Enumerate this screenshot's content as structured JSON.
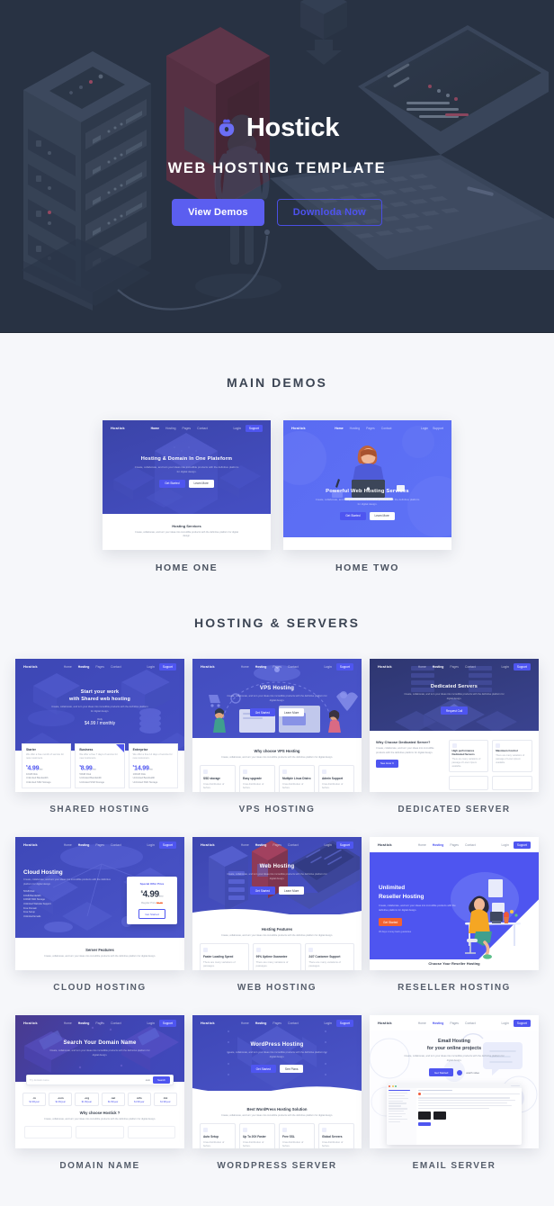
{
  "hero": {
    "brand_name": "Hostick",
    "logo_icon": "cloud-bag-icon",
    "subtitle": "WEB HOSTING TEMPLATE",
    "primary_button": "View Demos",
    "secondary_button": "Downloda Now",
    "bg_color": "#283243",
    "accent_color": "#5b5ef0"
  },
  "main_demos": {
    "title": "MAIN DEMOS",
    "items": [
      {
        "label": "HOME ONE",
        "nav": {
          "logo": "Hostick",
          "menu": [
            "Home",
            "Hosting",
            "Pages",
            "Contact"
          ],
          "active": "Home",
          "login": "Login",
          "cta": "Support"
        },
        "headline": "Hosting & Domain In One Plateform",
        "paragraph": "Create, collaborate, and turn your ideas into incredible products with the definitive platform for digital design.",
        "btn_primary": "Get Started",
        "btn_secondary": "Learn More",
        "section_title": "Hosting Services",
        "section_paragraph": "Create, collaborate, and turn your ideas into incredible products with the definitive platform for digital design."
      },
      {
        "label": "HOME TWO",
        "nav": {
          "logo": "Hostick",
          "menu": [
            "Home",
            "Hosting",
            "Pages",
            "Contact"
          ],
          "active": "Home",
          "login": "Login",
          "cta": "Support"
        },
        "headline": "Powerful Web Hosting Services",
        "paragraph": "Create, collaborate, and turn your ideas into incredible products with the definitive platform for digital design.",
        "btn_primary": "Get Started",
        "btn_secondary": "Learn More"
      }
    ]
  },
  "hosting_servers": {
    "title": "HOSTING & SERVERS",
    "items": [
      {
        "label": "SHARED HOSTING",
        "nav": {
          "logo": "Hostick",
          "menu": [
            "Home",
            "Hosting",
            "Pages",
            "Contact"
          ],
          "active": "Hosting",
          "login": "Login",
          "cta": "Support"
        },
        "headline_line1": "Start your work",
        "headline_line2": "with Shared web hosting",
        "paragraph": "Create, collaborate, and turn your ideas into incredible products with the definitive platform for digital design.",
        "offer_label": "Only",
        "offer_price": "$4.99 / monthly",
        "plans": [
          {
            "name": "Starter",
            "desc": "We offer a free month of service for new customers.",
            "price": "4.99",
            "currency": "$",
            "period": "/mo",
            "features": [
              "10GB Disk",
              "Unlimited Bandwidth",
              "Unlimited SSD Storage"
            ]
          },
          {
            "name": "Business",
            "desc": "We offer a free 7 days of service for new customers.",
            "price": "8.99",
            "currency": "$",
            "period": "/mo",
            "features": [
              "50GB Disk",
              "Unlimited Bandwidth",
              "Unlimited SSD Storage"
            ]
          },
          {
            "name": "Enterprise",
            "desc": "We offer a free 14 days of service for new customers.",
            "price": "14.99",
            "currency": "$",
            "period": "/mo",
            "features": [
              "100GB Disk",
              "Unlimited Bandwidth",
              "Unlimited SSD Storage"
            ]
          }
        ]
      },
      {
        "label": "VPS HOSTING",
        "nav": {
          "logo": "Hostick",
          "menu": [
            "Home",
            "Hosting",
            "Pages",
            "Contact"
          ],
          "active": "Hosting",
          "login": "Login",
          "cta": "Support"
        },
        "headline": "VPS Hosting",
        "paragraph": "Create, collaborate, and turn your ideas into incredible products with the definitive platform for digital design.",
        "btn_primary": "Get Started",
        "btn_secondary": "Learn More",
        "section_title": "Why choose VPS Hosting",
        "section_paragraph": "Create, collaborate, and turn your ideas into incredible products with the definitive platform for digital design.",
        "features": [
          {
            "title": "SSD storage",
            "desc": "Cras distribution of before."
          },
          {
            "title": "Easy upgrade",
            "desc": "Cras distribution of before."
          },
          {
            "title": "Multiple Linux Distro",
            "desc": "Cras distribution of before."
          },
          {
            "title": "Admin Support",
            "desc": "Cras distribution of before."
          }
        ]
      },
      {
        "label": "DEDICATED SERVER",
        "nav": {
          "logo": "Hostick",
          "menu": [
            "Home",
            "Hosting",
            "Pages",
            "Contact"
          ],
          "active": "Hosting",
          "login": "Login",
          "cta": "Support"
        },
        "headline": "Dedicated Servers",
        "paragraph": "Create, collaborate, and turn your ideas into incredible products with the definitive platform for digital design.",
        "btn_primary": "Request Call",
        "section_title": "Why Choose Dedicated Server?",
        "section_paragraph": "Create, collaborate, and turn your ideas into incredible products with the definitive platform for digital design.",
        "section_btn": "See How It",
        "cards": [
          {
            "title": "High performance Dedicated Servers",
            "desc": "There are many variations of passage of Lorem Ipsum available."
          },
          {
            "title": "Maximum Control",
            "desc": "There are many variations of passage of Lorem Ipsum available."
          }
        ]
      },
      {
        "label": "CLOUD HOSTING",
        "nav": {
          "logo": "Hostick",
          "menu": [
            "Home",
            "Hosting",
            "Pages",
            "Contact"
          ],
          "active": "Hosting",
          "login": "Login",
          "cta": "Support"
        },
        "headline": "Cloud Hosting",
        "paragraph": "Create, collaborate, and turn your ideas into incredible products with the definitive platform for digital design.",
        "bullets": [
          "50GB Disk",
          "10GB Bandwidth",
          "100GB SSD Storage",
          "Unlimited Website Support",
          "Free Domain",
          "Free Setup",
          "Unlimited Emails"
        ],
        "offer_label": "Special Offer Price",
        "offer_price": "4.99",
        "offer_currency": "$",
        "offer_period": "/mo",
        "offer_regular": "Regular Price",
        "offer_regular_price": "$9.99",
        "offer_btn": "Get Started",
        "section_title": "Server Features",
        "section_paragraph": "Create, collaborate, and turn your ideas into incredible products with the definitive platform for digital design."
      },
      {
        "label": "WEB HOSTING",
        "nav": {
          "logo": "Hostick",
          "menu": [
            "Home",
            "Hosting",
            "Pages",
            "Contact"
          ],
          "active": "Hosting",
          "login": "Login",
          "cta": "Support"
        },
        "headline": "Web Hosting",
        "paragraph": "Create, collaborate, and turn your ideas into incredible products with the definitive platform for digital design.",
        "btn_primary": "Get Started",
        "btn_secondary": "Learn More",
        "section_title": "Hosting Features",
        "section_paragraph": "Create, collaborate, and turn your ideas into incredible products with the definitive platform for digital design.",
        "features": [
          {
            "title": "Faster Loading Speed",
            "desc": "There are many variations of passages."
          },
          {
            "title": "99% Uptime Guarantee",
            "desc": "There are many variations of passages."
          },
          {
            "title": "24/7 Customer Support",
            "desc": "There are many variations of passages."
          }
        ]
      },
      {
        "label": "RESELLER HOSTING",
        "nav": {
          "logo": "Hostick",
          "menu": [
            "Home",
            "Hosting",
            "Pages",
            "Contact"
          ],
          "active": "Hosting",
          "login": "Login",
          "cta": "Support"
        },
        "headline_line1": "Unlimited",
        "headline_line2": "Reseller Hosting",
        "paragraph": "Create, collaborate, and turn your ideas into incredible products with the definitive platform for digital design.",
        "btn_primary": "Get Started",
        "note": "30 days money back guarantee",
        "section_title": "Choose Your Reseller Hosting"
      },
      {
        "label": "DOMAIN NAME",
        "nav": {
          "logo": "Hostick",
          "menu": [
            "Home",
            "Hosting",
            "Pages",
            "Contact"
          ],
          "active": "Hosting",
          "login": "Login",
          "cta": "Support"
        },
        "headline": "Search Your Domain Name",
        "paragraph": "Create, collaborate, and turn your ideas into incredible products with the definitive platform for digital design.",
        "search_placeholder": "Try domain name",
        "search_select": ".com",
        "search_btn": "Search",
        "tlds": [
          {
            "ext": ".in",
            "price": "$1.99/year"
          },
          {
            "ext": ".com",
            "price": "$1.99/year"
          },
          {
            "ext": ".org",
            "price": "$1.99/year"
          },
          {
            "ext": ".net",
            "price": "$1.99/year"
          },
          {
            "ext": ".info",
            "price": "$1.99/year"
          },
          {
            "ext": ".biz",
            "price": "$1.99/year"
          }
        ],
        "section_title": "Why choose Hostick ?",
        "section_paragraph": "Create, collaborate, and turn your ideas into incredible products with the definitive platform for digital design."
      },
      {
        "label": "WORDPRESS SERVER",
        "nav": {
          "logo": "Hostick",
          "menu": [
            "Home",
            "Hosting",
            "Pages",
            "Contact"
          ],
          "active": "Hosting",
          "login": "Login",
          "cta": "Support"
        },
        "headline": "WordPress Hosting",
        "paragraph": "Create, collaborate, and turn your ideas into incredible products with the definitive platform for digital design.",
        "btn_primary": "Get Started",
        "btn_secondary": "See Plans",
        "section_title": "Best WordPress Hosting Solution",
        "section_paragraph": "Create, collaborate, and turn your ideas into incredible products with the definitive platform for digital design.",
        "features": [
          {
            "title": "Auto Setup",
            "desc": "Cras distribution of before."
          },
          {
            "title": "Up To 20X Faster",
            "desc": "Cras distribution of before."
          },
          {
            "title": "Free SSL",
            "desc": "Cras distribution of before."
          },
          {
            "title": "Global Servers",
            "desc": "Cras distribution of before."
          }
        ]
      },
      {
        "label": "EMAIL SERVER",
        "nav": {
          "logo": "Hostick",
          "menu": [
            "Home",
            "Hosting",
            "Pages",
            "Contact"
          ],
          "active": "Hosting",
          "login": "Login",
          "cta": "Support"
        },
        "headline_line1": "Email Hosting",
        "headline_line2": "for your online projects",
        "paragraph": "Create, collaborate, and turn your ideas into incredible products with the definitive platform for digital design.",
        "btn_primary": "Get Started",
        "btn_video": "watch video"
      }
    ]
  }
}
